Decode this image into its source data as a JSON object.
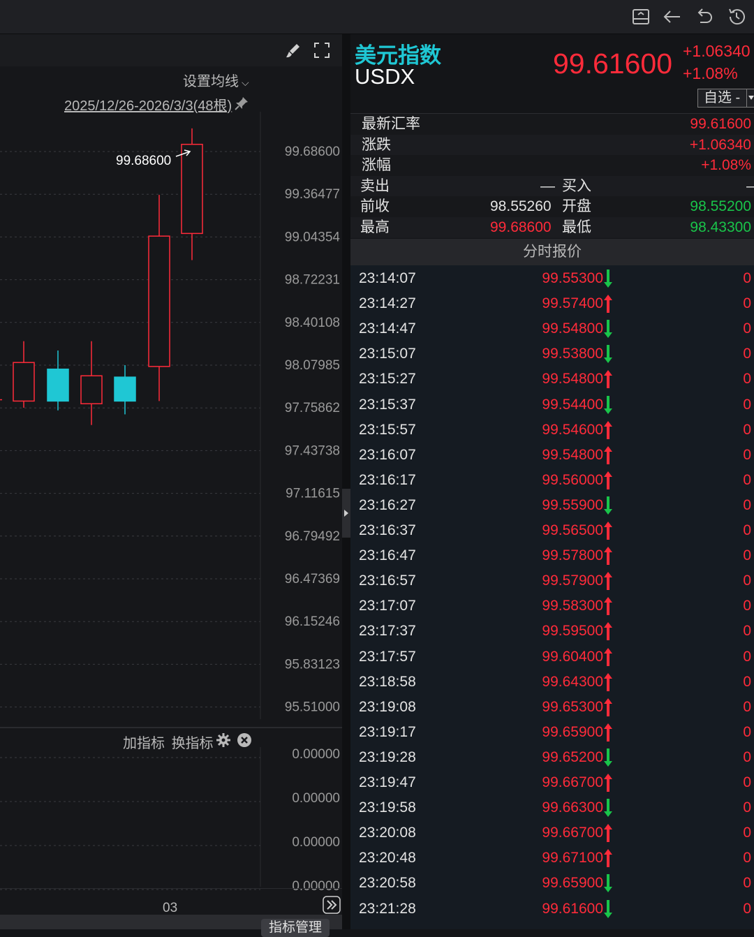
{
  "toolbar": {
    "icons": [
      "collapse-panel-icon",
      "back-arrow-icon",
      "undo-icon",
      "history-icon"
    ]
  },
  "chart": {
    "ma_label": "设置均线",
    "range_label": "2025/12/26-2026/3/3(48根)",
    "high_marker": "99.68600",
    "price_ticks": [
      "99.68600",
      "99.36477",
      "99.04354",
      "98.72231",
      "98.40108",
      "98.07985",
      "97.75862",
      "97.43738",
      "97.11615",
      "96.79492",
      "96.47369",
      "96.15246",
      "95.83123",
      "95.51000"
    ],
    "indicator_add": "加指标",
    "indicator_switch": "换指标",
    "indicator_ticks": [
      "0.00000",
      "0.00000",
      "0.00000",
      "0.00000"
    ],
    "x_label": "03",
    "indicator_manage": "指标管理",
    "colors": {
      "up": "#ff2b3a",
      "down": "#1fc7d4"
    }
  },
  "chart_data": {
    "type": "candlestick",
    "ylim": [
      95.51,
      99.686
    ],
    "candles": [
      {
        "open": 97.81,
        "close": 98.1,
        "high": 98.26,
        "low": 97.76,
        "dir": "up"
      },
      {
        "open": 98.05,
        "close": 97.81,
        "high": 98.19,
        "low": 97.74,
        "dir": "down"
      },
      {
        "open": 97.79,
        "close": 98.0,
        "high": 98.26,
        "low": 97.63,
        "dir": "up"
      },
      {
        "open": 97.99,
        "close": 97.81,
        "high": 98.08,
        "low": 97.71,
        "dir": "down"
      },
      {
        "open": 98.07,
        "close": 99.05,
        "high": 99.36,
        "low": 97.81,
        "dir": "up"
      },
      {
        "open": 99.07,
        "close": 99.74,
        "high": 99.86,
        "low": 98.87,
        "dir": "up"
      }
    ]
  },
  "quote": {
    "name_cn": "美元指数",
    "symbol": "USDX",
    "price": "99.61600",
    "change": "+1.06340",
    "change_pct": "+1.08%",
    "watchlist_label": "自选 -",
    "stats": {
      "latest_label": "最新汇率",
      "latest": "99.61600",
      "change_label": "涨跌",
      "change": "+1.06340",
      "pct_label": "涨幅",
      "pct": "+1.08%",
      "sell_label": "卖出",
      "sell": "—",
      "buy_label": "买入",
      "buy": "—",
      "prev_label": "前收",
      "prev": "98.55260",
      "open_label": "开盘",
      "open": "98.55200",
      "high_label": "最高",
      "high": "99.68600",
      "low_label": "最低",
      "low": "98.43300"
    },
    "ticks_header": "分时报价",
    "ticks": [
      {
        "time": "23:14:07",
        "price": "99.55300",
        "dir": "down",
        "vol": "0"
      },
      {
        "time": "23:14:27",
        "price": "99.57400",
        "dir": "up",
        "vol": "0"
      },
      {
        "time": "23:14:47",
        "price": "99.54800",
        "dir": "down",
        "vol": "0"
      },
      {
        "time": "23:15:07",
        "price": "99.53800",
        "dir": "down",
        "vol": "0"
      },
      {
        "time": "23:15:27",
        "price": "99.54800",
        "dir": "up",
        "vol": "0"
      },
      {
        "time": "23:15:37",
        "price": "99.54400",
        "dir": "down",
        "vol": "0"
      },
      {
        "time": "23:15:57",
        "price": "99.54600",
        "dir": "up",
        "vol": "0"
      },
      {
        "time": "23:16:07",
        "price": "99.54800",
        "dir": "up",
        "vol": "0"
      },
      {
        "time": "23:16:17",
        "price": "99.56000",
        "dir": "up",
        "vol": "0"
      },
      {
        "time": "23:16:27",
        "price": "99.55900",
        "dir": "down",
        "vol": "0"
      },
      {
        "time": "23:16:37",
        "price": "99.56500",
        "dir": "up",
        "vol": "0"
      },
      {
        "time": "23:16:47",
        "price": "99.57800",
        "dir": "up",
        "vol": "0"
      },
      {
        "time": "23:16:57",
        "price": "99.57900",
        "dir": "up",
        "vol": "0"
      },
      {
        "time": "23:17:07",
        "price": "99.58300",
        "dir": "up",
        "vol": "0"
      },
      {
        "time": "23:17:37",
        "price": "99.59500",
        "dir": "up",
        "vol": "0"
      },
      {
        "time": "23:17:57",
        "price": "99.60400",
        "dir": "up",
        "vol": "0"
      },
      {
        "time": "23:18:58",
        "price": "99.64300",
        "dir": "up",
        "vol": "0"
      },
      {
        "time": "23:19:08",
        "price": "99.65300",
        "dir": "up",
        "vol": "0"
      },
      {
        "time": "23:19:17",
        "price": "99.65900",
        "dir": "up",
        "vol": "0"
      },
      {
        "time": "23:19:28",
        "price": "99.65200",
        "dir": "down",
        "vol": "0"
      },
      {
        "time": "23:19:47",
        "price": "99.66700",
        "dir": "up",
        "vol": "0"
      },
      {
        "time": "23:19:58",
        "price": "99.66300",
        "dir": "down",
        "vol": "0"
      },
      {
        "time": "23:20:08",
        "price": "99.66700",
        "dir": "up",
        "vol": "0"
      },
      {
        "time": "23:20:48",
        "price": "99.67100",
        "dir": "up",
        "vol": "0"
      },
      {
        "time": "23:20:58",
        "price": "99.65900",
        "dir": "down",
        "vol": "0"
      },
      {
        "time": "23:21:28",
        "price": "99.61600",
        "dir": "down",
        "vol": "0"
      }
    ]
  }
}
